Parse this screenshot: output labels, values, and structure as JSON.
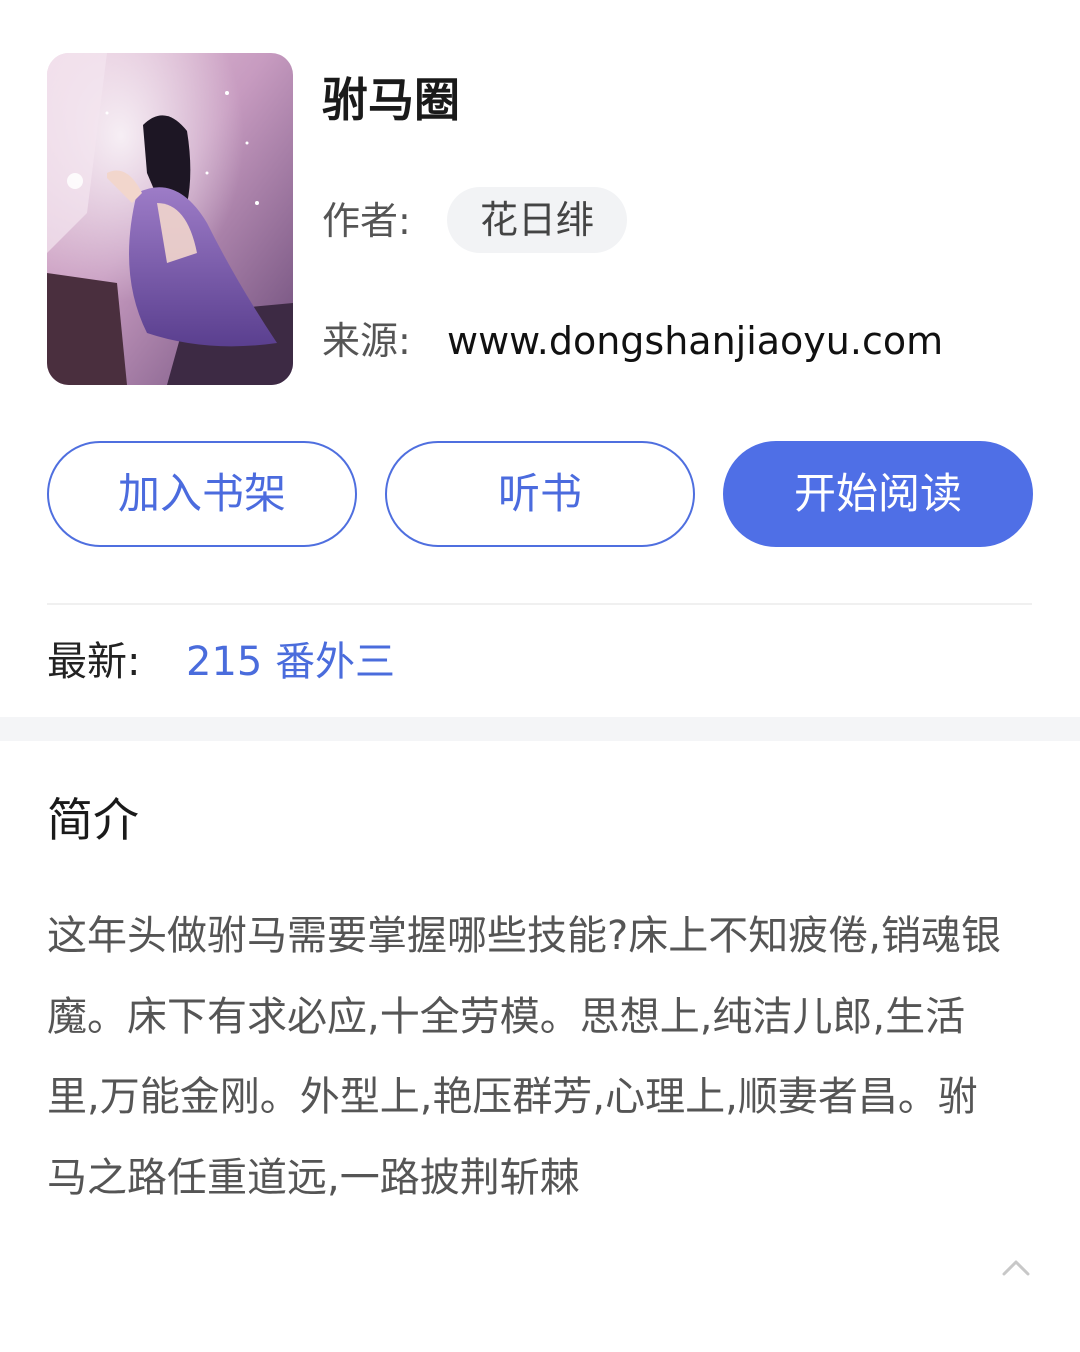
{
  "book": {
    "title": "驸马圈",
    "author_label": "作者:",
    "author": "花日绯",
    "source_label": "来源:",
    "source": "www.dongshanjiaoyu.com"
  },
  "actions": {
    "add_shelf": "加入书架",
    "listen": "听书",
    "start_reading": "开始阅读"
  },
  "latest": {
    "label": "最新:",
    "chapter": "215 番外三"
  },
  "intro": {
    "heading": "简介",
    "text": "这年头做驸马需要掌握哪些技能?床上不知疲倦,销魂银魔。床下有求必应,十全劳模。思想上,纯洁儿郎,生活里,万能金刚。外型上,艳压群芳,心理上,顺妻者昌。驸马之路任重道远,一路披荆斩棘"
  },
  "icons": {
    "collapse": "chevron-up-icon"
  },
  "colors": {
    "accent": "#4f6fe6",
    "chip_bg": "#f2f3f5",
    "section_gap": "#f4f5f7"
  }
}
